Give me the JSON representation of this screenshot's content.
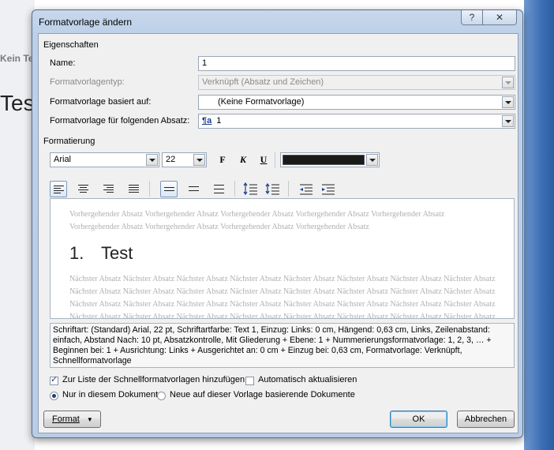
{
  "background": {
    "doc_style_label": "Kein Te",
    "doc_text": "Tes"
  },
  "dialog": {
    "title": "Formatvorlage ändern",
    "help_label": "?",
    "close_label": "✕"
  },
  "properties": {
    "group_label": "Eigenschaften",
    "name_label": "Name:",
    "name_value": "1",
    "type_label": "Formatvorlagentyp:",
    "type_value": "Verknüpft (Absatz und Zeichen)",
    "based_label": "Formatvorlage basiert auf:",
    "based_value": "(Keine Formatvorlage)",
    "next_label": "Formatvorlage für folgenden Absatz:",
    "next_value": "1",
    "next_icon": "¶a"
  },
  "formatting": {
    "group_label": "Formatierung",
    "font": "Arial",
    "size": "22",
    "bold_label": "F",
    "italic_label": "K",
    "underline_label": "U",
    "color": "#1a1a1a"
  },
  "preview": {
    "previous_text": "Vorhergehender Absatz Vorhergehender Absatz Vorhergehender Absatz Vorhergehender Absatz Vorhergehender Absatz Vorhergehender Absatz Vorhergehender Absatz Vorhergehender Absatz Vorhergehender Absatz",
    "sample_number": "1.",
    "sample_text": "Test",
    "next_text": "Nächster Absatz Nächster Absatz Nächster Absatz Nächster Absatz Nächster Absatz Nächster Absatz Nächster Absatz Nächster Absatz Nächster Absatz Nächster Absatz Nächster Absatz Nächster Absatz Nächster Absatz Nächster Absatz Nächster Absatz Nächster Absatz Nächster Absatz Nächster Absatz Nächster Absatz Nächster Absatz Nächster Absatz Nächster Absatz Nächster Absatz Nächster Absatz Nächster Absatz Nächster Absatz Nächster Absatz Nächster Absatz Nächster Absatz Nächster Absatz Nächster Absatz Nächster Absatz"
  },
  "description": "Schriftart: (Standard) Arial, 22 pt, Schriftartfarbe: Text 1, Einzug: Links:  0 cm, Hängend:  0,63 cm, Links, Zeilenabstand: einfach, Abstand Nach:  10 pt, Absatzkontrolle, Mit Gliederung + Ebene: 1 + Nummerierungsformatvorlage: 1, 2, 3, … + Beginnen bei: 1 + Ausrichtung: Links + Ausgerichtet an:  0 cm + Einzug bei:  0,63 cm, Formatvorlage: Verknüpft, Schnellformatvorlage",
  "options": {
    "quick_list_label": "Zur Liste der Schnellformatvorlagen hinzufügen",
    "quick_list_checked": true,
    "auto_update_label": "Automatisch aktualisieren",
    "auto_update_checked": false,
    "only_doc_label": "Nur in diesem Dokument",
    "new_docs_label": "Neue auf dieser Vorlage basierende Dokumente"
  },
  "buttons": {
    "format_label": "Format",
    "ok_label": "OK",
    "cancel_label": "Abbrechen"
  }
}
